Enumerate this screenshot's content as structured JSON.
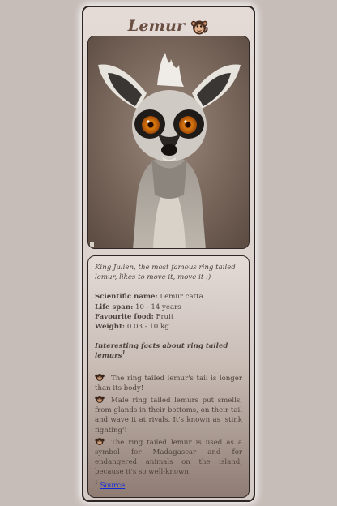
{
  "card": {
    "title": "Lemur",
    "quote": "King Julien, the most famous ring tailed lemur, likes to move it, move it :)",
    "facts": [
      {
        "label": "Scientific name:",
        "value": "Lemur catta"
      },
      {
        "label": "Life span:",
        "value": "10 - 14 years"
      },
      {
        "label": "Favourite food:",
        "value": "Fruit"
      },
      {
        "label": "Weight:",
        "value": "0.03 - 10 kg"
      }
    ],
    "interesting_heading": "Interesting facts about ring tailed lemurs",
    "interesting_sup": "1",
    "interesting_facts": [
      "The ring tailed lemur's tail is longer than its body!",
      "Male ring tailed lemurs put smells, from glands in their bottoms, on their tail and wave it at rivals. It's known as 'stink fighting'!",
      "The ring tailed lemur is used as a symbol for Madagascar and for endangered animals on the island, because it's so well-known."
    ],
    "source_sup": "1",
    "source_label": "Source"
  },
  "icons": {
    "title_icon": "monkey-icon",
    "fact_icon": "monkey-icon"
  },
  "colors": {
    "page_background": "#c6bcb8",
    "title": "#6a4e42",
    "link": "#1428d8"
  }
}
